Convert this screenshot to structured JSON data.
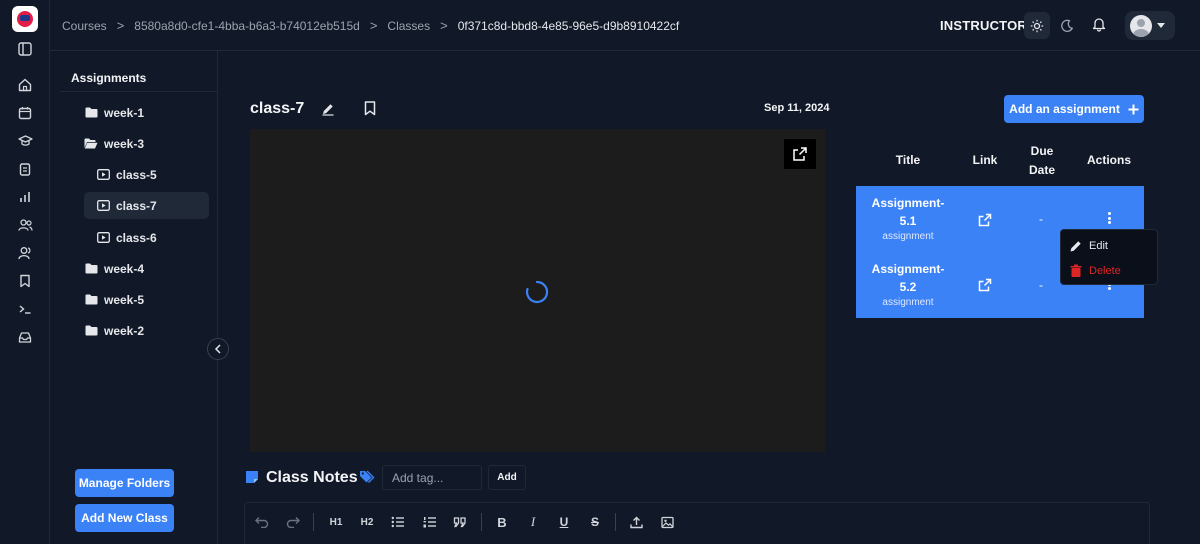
{
  "breadcrumb": {
    "items": [
      "Courses",
      "8580a8d0-cfe1-4bba-b6a3-b74012eb515d",
      "Classes",
      "0f371c8d-bbd8-4e85-96e5-d9b8910422cf"
    ],
    "separator": ">"
  },
  "header": {
    "role": "INSTRUCTOR"
  },
  "rail": {
    "icons": [
      "sidebar-toggle-icon",
      "home-icon",
      "calendar-icon",
      "graduation-cap-icon",
      "clipboard-icon",
      "bar-chart-icon",
      "users-icon",
      "user-group-icon",
      "bookmark-icon",
      "terminal-icon",
      "inbox-icon"
    ]
  },
  "folders": {
    "title": "Assignments",
    "items": [
      {
        "label": "week-1",
        "kind": "folder"
      },
      {
        "label": "week-3",
        "kind": "folder-open"
      },
      {
        "label": "class-5",
        "kind": "class"
      },
      {
        "label": "class-7",
        "kind": "class",
        "selected": true
      },
      {
        "label": "class-6",
        "kind": "class"
      },
      {
        "label": "week-4",
        "kind": "folder"
      },
      {
        "label": "week-5",
        "kind": "folder"
      },
      {
        "label": "week-2",
        "kind": "folder"
      }
    ],
    "manage_label": "Manage Folders",
    "add_class_label": "Add New Class"
  },
  "class": {
    "title": "class-7",
    "date": "Sep 11, 2024"
  },
  "assignments": {
    "add_label": "Add an assignment",
    "columns": [
      "Title",
      "Link",
      "Due Date",
      "Actions"
    ],
    "rows": [
      {
        "title": "Assignment-5.1",
        "type": "assignment",
        "due": "-"
      },
      {
        "title": "Assignment-5.2",
        "type": "assignment",
        "due": "-"
      }
    ]
  },
  "menu": {
    "edit_label": "Edit",
    "delete_label": "Delete"
  },
  "notes": {
    "title": "Class Notes",
    "tag_placeholder": "Add tag...",
    "tag_add_label": "Add",
    "toolbar": {
      "h1": "H1",
      "h2": "H2",
      "bold": "B",
      "italic": "I",
      "underline": "U",
      "strike": "S"
    }
  },
  "colors": {
    "background": "#111827",
    "accent": "#3b82f6",
    "danger": "#dc2626",
    "video": "#1c1c1c"
  }
}
